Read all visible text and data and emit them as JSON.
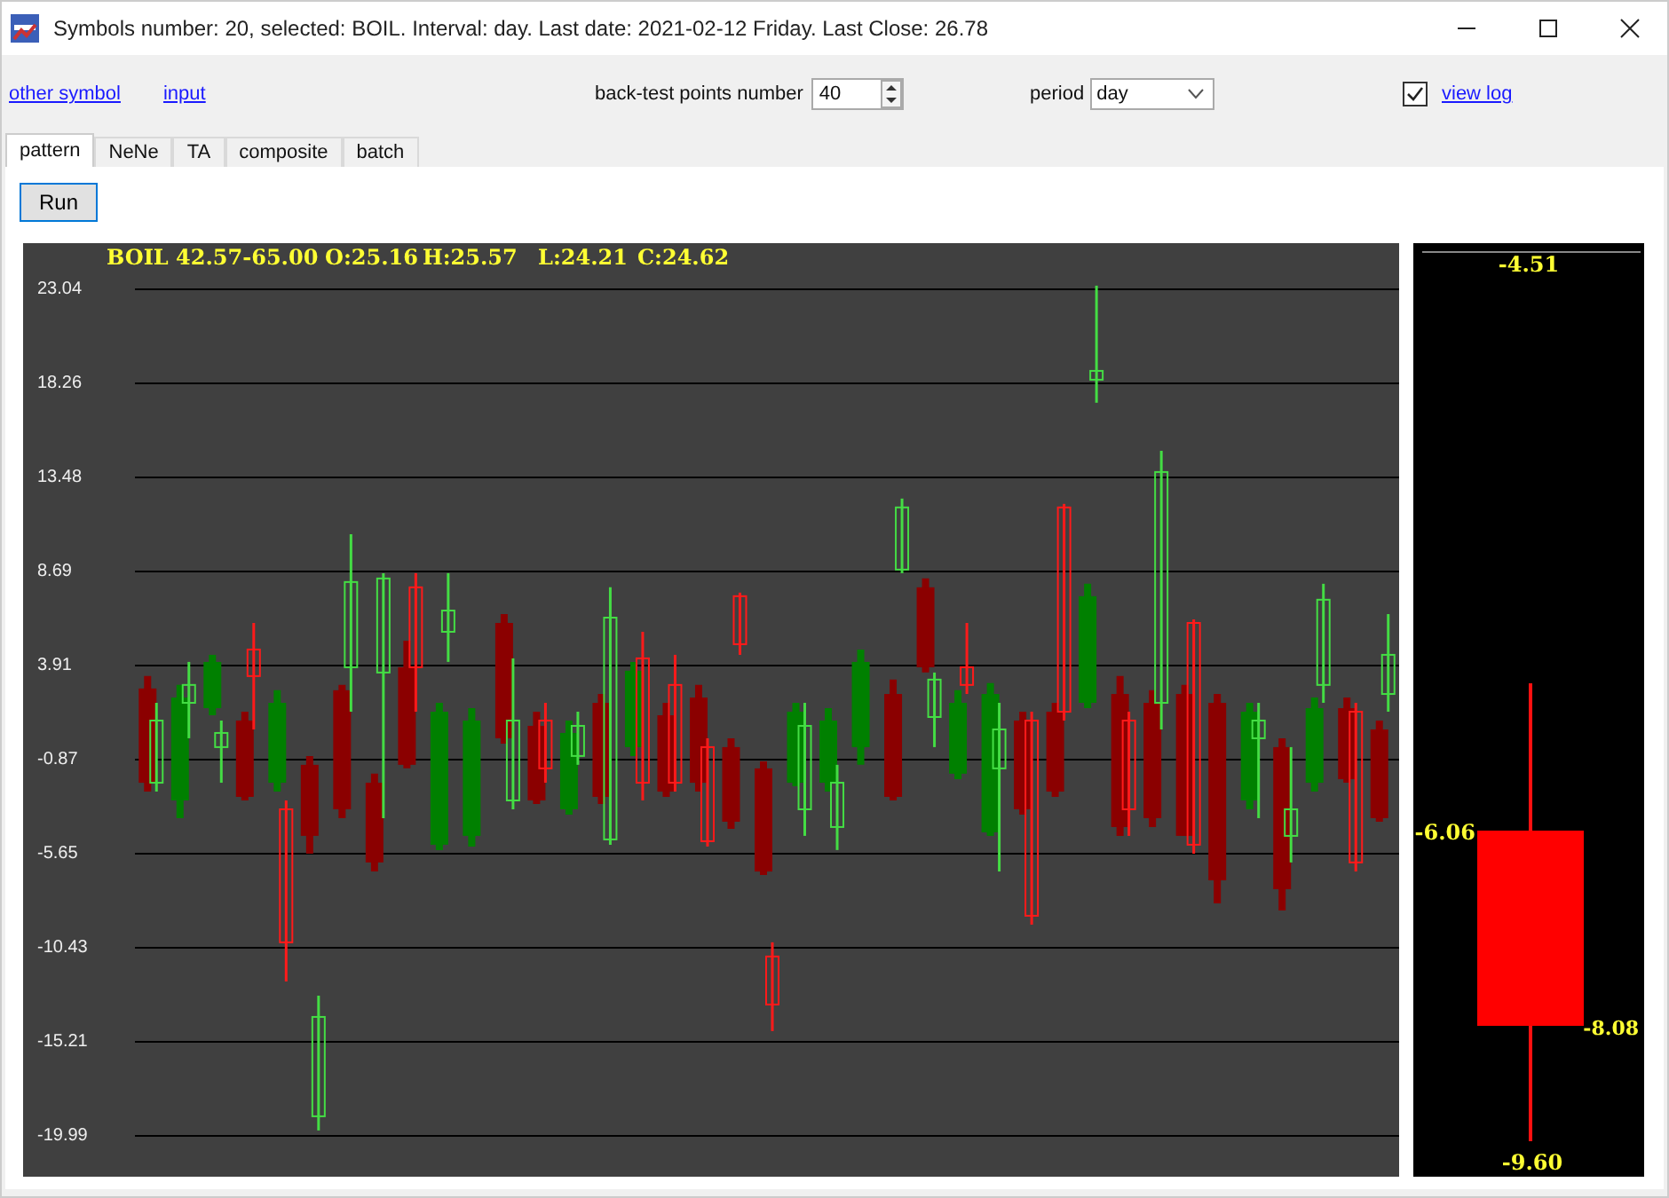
{
  "window": {
    "title": "Symbols number: 20, selected:  BOIL. Interval: day.  Last date: 2021-02-12 Friday.  Last Close: 26.78"
  },
  "toolbar": {
    "links": [
      "other symbol",
      "input"
    ],
    "backtest": {
      "label": "back-test points number",
      "value": "40"
    },
    "period": {
      "label": "period",
      "value": "day"
    },
    "view_log": {
      "label": "view log",
      "checked": true
    }
  },
  "tabs": [
    {
      "label": "pattern",
      "selected": true
    },
    {
      "label": "NeNe",
      "selected": false
    },
    {
      "label": "TA",
      "selected": false
    },
    {
      "label": "composite",
      "selected": false
    },
    {
      "label": "batch",
      "selected": false
    }
  ],
  "run_button": "Run",
  "chart": {
    "header": [
      "BOIL 42.57-65.00",
      "O:25.16",
      "H:25.57",
      "L:24.21",
      "C:24.62"
    ],
    "chart_data": {
      "type": "candlestick",
      "grid": true,
      "ylim": [
        -22.06,
        25.38
      ],
      "yticks": [
        23.04,
        18.26,
        13.48,
        8.69,
        3.91,
        -0.87,
        -5.65,
        -10.43,
        -15.21,
        -19.99
      ],
      "categories": [
        null,
        null,
        null,
        null,
        null,
        null,
        null,
        null,
        null,
        null,
        null,
        null,
        null,
        null,
        null,
        null,
        null,
        null,
        null,
        null,
        null,
        null,
        null,
        null,
        null,
        null,
        null,
        null,
        null,
        null,
        null,
        null,
        null,
        null,
        null,
        null,
        null,
        null,
        null
      ],
      "series": [
        {
          "color": "#8b0000",
          "ohlc": [
            [
              2.75,
              3.38,
              -2.49,
              -2.04
            ],
            null,
            null,
            [
              1.12,
              1.57,
              -2.94,
              -2.76
            ],
            null,
            [
              -1.13,
              -0.68,
              -5.64,
              -4.74
            ],
            [
              2.66,
              2.93,
              -3.84,
              -3.39
            ],
            [
              -2.04,
              -1.58,
              -6.55,
              -6.09
            ],
            [
              3.83,
              5.18,
              -1.31,
              -1.13
            ],
            null,
            null,
            [
              6.08,
              6.53,
              -0.05,
              0.22
            ],
            [
              0.85,
              1.57,
              -3.12,
              -2.94
            ],
            null,
            [
              2.02,
              2.47,
              -3.12,
              -2.76
            ],
            null,
            [
              1.39,
              2.02,
              -2.76,
              -2.49
            ],
            [
              2.29,
              2.93,
              -2.49,
              -2.04
            ],
            [
              -0.23,
              0.22,
              -4.38,
              -4.02
            ],
            [
              -1.31,
              -0.95,
              -6.73,
              -6.55
            ],
            null,
            null,
            null,
            [
              2.47,
              3.2,
              -2.94,
              -2.76
            ],
            [
              7.89,
              8.34,
              3.56,
              3.83
            ],
            null,
            null,
            [
              1.12,
              1.57,
              -3.66,
              -3.39
            ],
            [
              1.57,
              2.02,
              -2.76,
              -2.49
            ],
            null,
            [
              2.47,
              3.38,
              -4.74,
              -4.29
            ],
            [
              2.02,
              2.66,
              -4.29,
              -3.84
            ],
            [
              2.47,
              2.93,
              -4.74,
              -4.74
            ],
            [
              2.02,
              2.47,
              -8.17,
              -7.0
            ],
            null,
            [
              -0.23,
              0.22,
              -8.53,
              -7.45
            ],
            null,
            [
              1.75,
              2.29,
              -2.04,
              -1.86
            ],
            [
              0.67,
              1.12,
              -4.02,
              -3.84
            ]
          ]
        },
        {
          "color": "#008000",
          "ohlc": [
            null,
            [
              -2.94,
              2.93,
              -3.84,
              2.29
            ],
            [
              1.75,
              4.46,
              1.39,
              4.1
            ],
            null,
            [
              -2.04,
              2.66,
              -2.49,
              2.02
            ],
            null,
            null,
            null,
            null,
            [
              -5.19,
              2.02,
              -5.46,
              1.57
            ],
            [
              -4.74,
              1.75,
              -5.28,
              1.12
            ],
            null,
            null,
            [
              -3.39,
              1.12,
              -3.66,
              0.49
            ],
            null,
            [
              -0.23,
              4.1,
              -0.68,
              3.65
            ],
            null,
            null,
            null,
            null,
            [
              -2.04,
              2.02,
              -2.22,
              1.57
            ],
            [
              -2.04,
              1.75,
              -2.49,
              1.12
            ],
            [
              -0.23,
              4.73,
              -1.13,
              4.1
            ],
            null,
            null,
            [
              -1.58,
              2.66,
              -1.86,
              2.02
            ],
            [
              -4.56,
              3.02,
              -4.74,
              2.47
            ],
            null,
            null,
            [
              2.02,
              8.07,
              1.75,
              7.44
            ],
            null,
            null,
            null,
            null,
            [
              -2.94,
              2.02,
              -3.39,
              1.57
            ],
            null,
            [
              -2.04,
              2.29,
              -2.49,
              1.75
            ],
            null,
            null
          ]
        },
        {
          "color": "#ff1a1a",
          "ohlc": [
            null,
            null,
            null,
            [
              4.73,
              6.08,
              0.67,
              3.38
            ],
            [
              -3.39,
              -2.94,
              -12.14,
              -10.15
            ],
            null,
            null,
            null,
            [
              7.89,
              8.61,
              1.57,
              3.83
            ],
            null,
            null,
            null,
            [
              1.12,
              2.02,
              -2.04,
              -1.31
            ],
            null,
            null,
            [
              4.28,
              5.63,
              -2.94,
              -2.04
            ],
            [
              2.93,
              4.46,
              -2.49,
              -2.04
            ],
            [
              -0.23,
              0.22,
              -5.28,
              -5.01
            ],
            [
              7.44,
              7.62,
              4.46,
              5.0
            ],
            [
              -10.87,
              -10.15,
              -14.66,
              -13.31
            ],
            null,
            null,
            null,
            null,
            null,
            [
              3.83,
              6.08,
              2.47,
              2.93
            ],
            null,
            [
              1.12,
              1.57,
              -9.25,
              -8.8
            ],
            [
              11.95,
              12.13,
              1.12,
              1.57
            ],
            null,
            [
              1.12,
              1.57,
              -4.74,
              -3.39
            ],
            null,
            [
              6.08,
              6.26,
              -5.64,
              -5.19
            ],
            null,
            null,
            null,
            null,
            [
              1.57,
              2.02,
              -6.55,
              -6.09
            ],
            null
          ]
        },
        {
          "color": "#44dd44",
          "ohlc": [
            [
              -2.04,
              2.02,
              -2.49,
              1.12
            ],
            [
              2.02,
              4.1,
              0.22,
              2.93
            ],
            [
              -0.23,
              1.12,
              -2.04,
              0.49
            ],
            null,
            null,
            [
              -18.99,
              -12.86,
              -19.71,
              -13.94
            ],
            [
              3.83,
              10.59,
              1.57,
              8.16
            ],
            [
              3.56,
              8.61,
              -3.84,
              8.34
            ],
            null,
            [
              5.63,
              8.61,
              4.1,
              6.71
            ],
            null,
            [
              -2.94,
              4.28,
              -3.39,
              1.12
            ],
            null,
            [
              -0.68,
              1.57,
              -1.13,
              0.85
            ],
            [
              -4.92,
              7.89,
              -5.19,
              6.35
            ],
            null,
            null,
            null,
            null,
            null,
            [
              -3.39,
              2.02,
              -4.74,
              0.85
            ],
            [
              -4.29,
              -1.13,
              -5.46,
              -2.04
            ],
            null,
            [
              8.79,
              12.4,
              8.61,
              11.95
            ],
            [
              1.3,
              3.56,
              -0.23,
              3.2
            ],
            null,
            [
              -1.31,
              2.02,
              -6.55,
              0.67
            ],
            null,
            null,
            [
              18.44,
              23.22,
              17.27,
              18.89
            ],
            null,
            [
              2.02,
              14.83,
              0.67,
              13.75
            ],
            null,
            null,
            [
              0.22,
              2.02,
              -3.84,
              1.12
            ],
            [
              -4.74,
              -0.23,
              -6.09,
              -3.39
            ],
            [
              2.93,
              8.07,
              2.02,
              7.26
            ],
            null,
            [
              2.47,
              6.53,
              1.57,
              4.46
            ]
          ]
        }
      ]
    }
  },
  "side_panel": {
    "labels": [
      {
        "kind": "high",
        "text": "-4.51"
      },
      {
        "kind": "open",
        "text": "-6.06"
      },
      {
        "kind": "close",
        "text": "-8.08"
      },
      {
        "kind": "low",
        "text": "-9.60"
      }
    ]
  }
}
